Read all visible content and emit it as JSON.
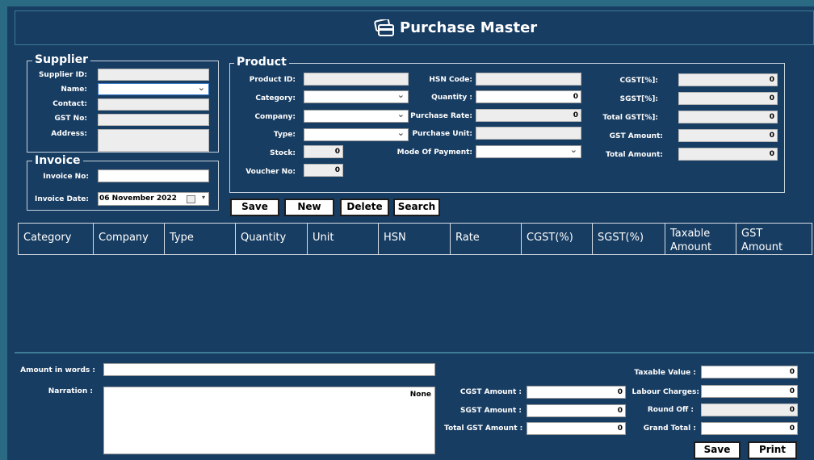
{
  "header": {
    "title": "Purchase Master"
  },
  "supplier": {
    "legend": "Supplier",
    "labels": {
      "id": "Supplier ID:",
      "name": "Name:",
      "contact": "Contact:",
      "gst": "GST No:",
      "address": "Address:"
    }
  },
  "invoice": {
    "legend": "Invoice",
    "labels": {
      "no": "Invoice No:",
      "date": "Invoice Date:"
    },
    "date_value": "06 November  2022"
  },
  "product": {
    "legend": "Product",
    "labels": {
      "id": "Product ID:",
      "category": "Category:",
      "company": "Company:",
      "type": "Type:",
      "stock": "Stock:",
      "voucher": "Voucher No:",
      "hsn": "HSN Code:",
      "quantity": "Quantity :",
      "rate": "Purchase Rate:",
      "unit": "Purchase Unit:",
      "payment": "Mode Of Payment:",
      "cgst": "CGST[%]:",
      "sgst": "SGST[%]:",
      "total_gst": "Total GST[%]:",
      "gst_amount": "GST Amount:",
      "total_amount": "Total Amount:"
    },
    "values": {
      "stock": "0",
      "voucher": "0",
      "quantity": "0",
      "rate": "0",
      "cgst": "0",
      "sgst": "0",
      "total_gst": "0",
      "gst_amount": "0",
      "total_amount": "0"
    }
  },
  "buttons": {
    "save": "Save",
    "new": "New",
    "delete": "Delete",
    "search": "Search",
    "save2": "Save",
    "print": "Print"
  },
  "table": {
    "columns": [
      "Category",
      "Company",
      "Type",
      "Quantity",
      "Unit",
      "HSN",
      "Rate",
      "CGST(%)",
      "SGST(%)",
      "Taxable Amount",
      "GST Amount"
    ]
  },
  "footer": {
    "labels": {
      "words": "Amount in words :",
      "narration": "Narration :",
      "cgst": "CGST Amount :",
      "sgst": "SGST Amount :",
      "total_gst": "Total GST Amount :",
      "taxable": "Taxable Value :",
      "labour": "Labour Charges:",
      "round": "Round Off :",
      "grand": "Grand Total :"
    },
    "narration_value": "None",
    "values": {
      "cgst": "0",
      "sgst": "0",
      "total_gst": "0",
      "taxable": "0",
      "labour": "0",
      "round": "0",
      "grand": "0"
    }
  }
}
